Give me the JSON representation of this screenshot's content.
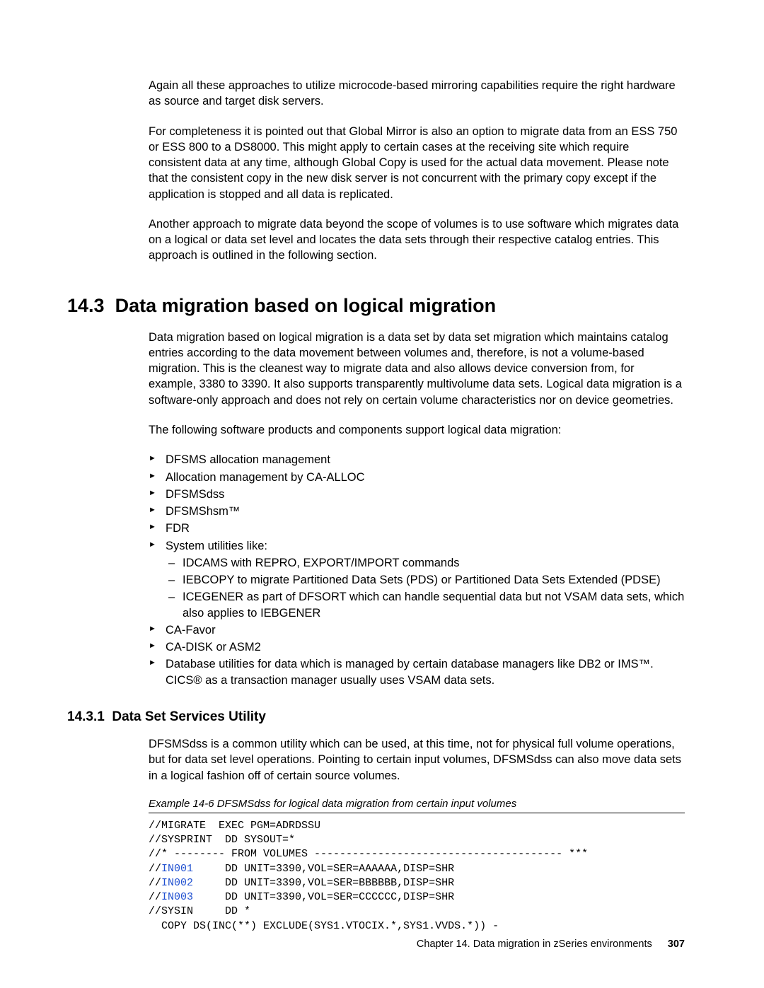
{
  "paragraphs": {
    "p1": "Again all these approaches to utilize microcode-based mirroring capabilities require the right hardware as source and target disk servers.",
    "p2": "For completeness it is pointed out that Global Mirror is also an option to migrate data from an ESS 750 or ESS 800 to a DS8000. This might apply to certain cases at the receiving site which require consistent data at any time, although Global Copy is used for the actual data movement. Please note that the consistent copy in the new disk server is not concurrent with the primary copy except if the application is stopped and all data is replicated.",
    "p3": "Another approach to migrate data beyond the scope of volumes is to use software which migrates data on a logical or data set level and locates the data sets through their respective catalog entries. This approach is outlined in the following section.",
    "p4": "Data migration based on logical migration is a data set by data set migration which maintains catalog entries according to the data movement between volumes and, therefore, is not a volume-based migration. This is the cleanest way to migrate data and also allows device conversion from, for example, 3380 to 3390. It also supports transparently multivolume data sets. Logical data migration is a software-only approach and does not rely on certain volume characteristics nor on device geometries.",
    "p5": "The following software products and components support logical data migration:",
    "p6": "DFSMSdss is a common utility which can be used, at this time, not for physical full volume operations, but for data set level operations. Pointing to certain input volumes, DFSMSdss can also move data sets in a logical fashion off of certain source volumes."
  },
  "section": {
    "num": "14.3",
    "title": "Data migration based on logical migration"
  },
  "subsection": {
    "num": "14.3.1",
    "title": "Data Set Services Utility"
  },
  "bullets": {
    "b1": "DFSMS allocation management",
    "b2": "Allocation management by CA-ALLOC",
    "b3": "DFSMSdss",
    "b4": "DFSMShsm™",
    "b5": "FDR",
    "b6": "System utilities like:",
    "b6a": "IDCAMS with REPRO, EXPORT/IMPORT commands",
    "b6b": "IEBCOPY to migrate Partitioned Data Sets (PDS) or Partitioned Data Sets Extended (PDSE)",
    "b6c": "ICEGENER as part of DFSORT which can handle sequential data but not VSAM data sets, which also applies to IEBGENER",
    "b7": "CA-Favor",
    "b8": "CA-DISK or ASM2",
    "b9": "Database utilities for data which is managed by certain database managers like DB2 or IMS™. CICS® as a transaction manager usually uses VSAM data sets."
  },
  "example": {
    "caption": "Example 14-6   DFSMSdss for logical data migration from certain input volumes",
    "lines": {
      "l1": "//MIGRATE  EXEC PGM=ADRDSSU",
      "l2": "//SYSPRINT  DD SYSOUT=*",
      "l3": "//* -------- FROM VOLUMES --------------------------------------- ***",
      "l4a": "//",
      "l4b": "IN001",
      "l4c": "     DD UNIT=3390,VOL=SER=AAAAAA,DISP=SHR",
      "l5a": "//",
      "l5b": "IN002",
      "l5c": "     DD UNIT=3390,VOL=SER=BBBBBB,DISP=SHR",
      "l6a": "//",
      "l6b": "IN003",
      "l6c": "     DD UNIT=3390,VOL=SER=CCCCCC,DISP=SHR",
      "l7": "//SYSIN     DD *",
      "l8": "  COPY DS(INC(**) EXCLUDE(SYS1.VTOCIX.*,SYS1.VVDS.*)) -"
    }
  },
  "footer": {
    "chapter": "Chapter 14. Data migration in zSeries environments",
    "page": "307"
  }
}
